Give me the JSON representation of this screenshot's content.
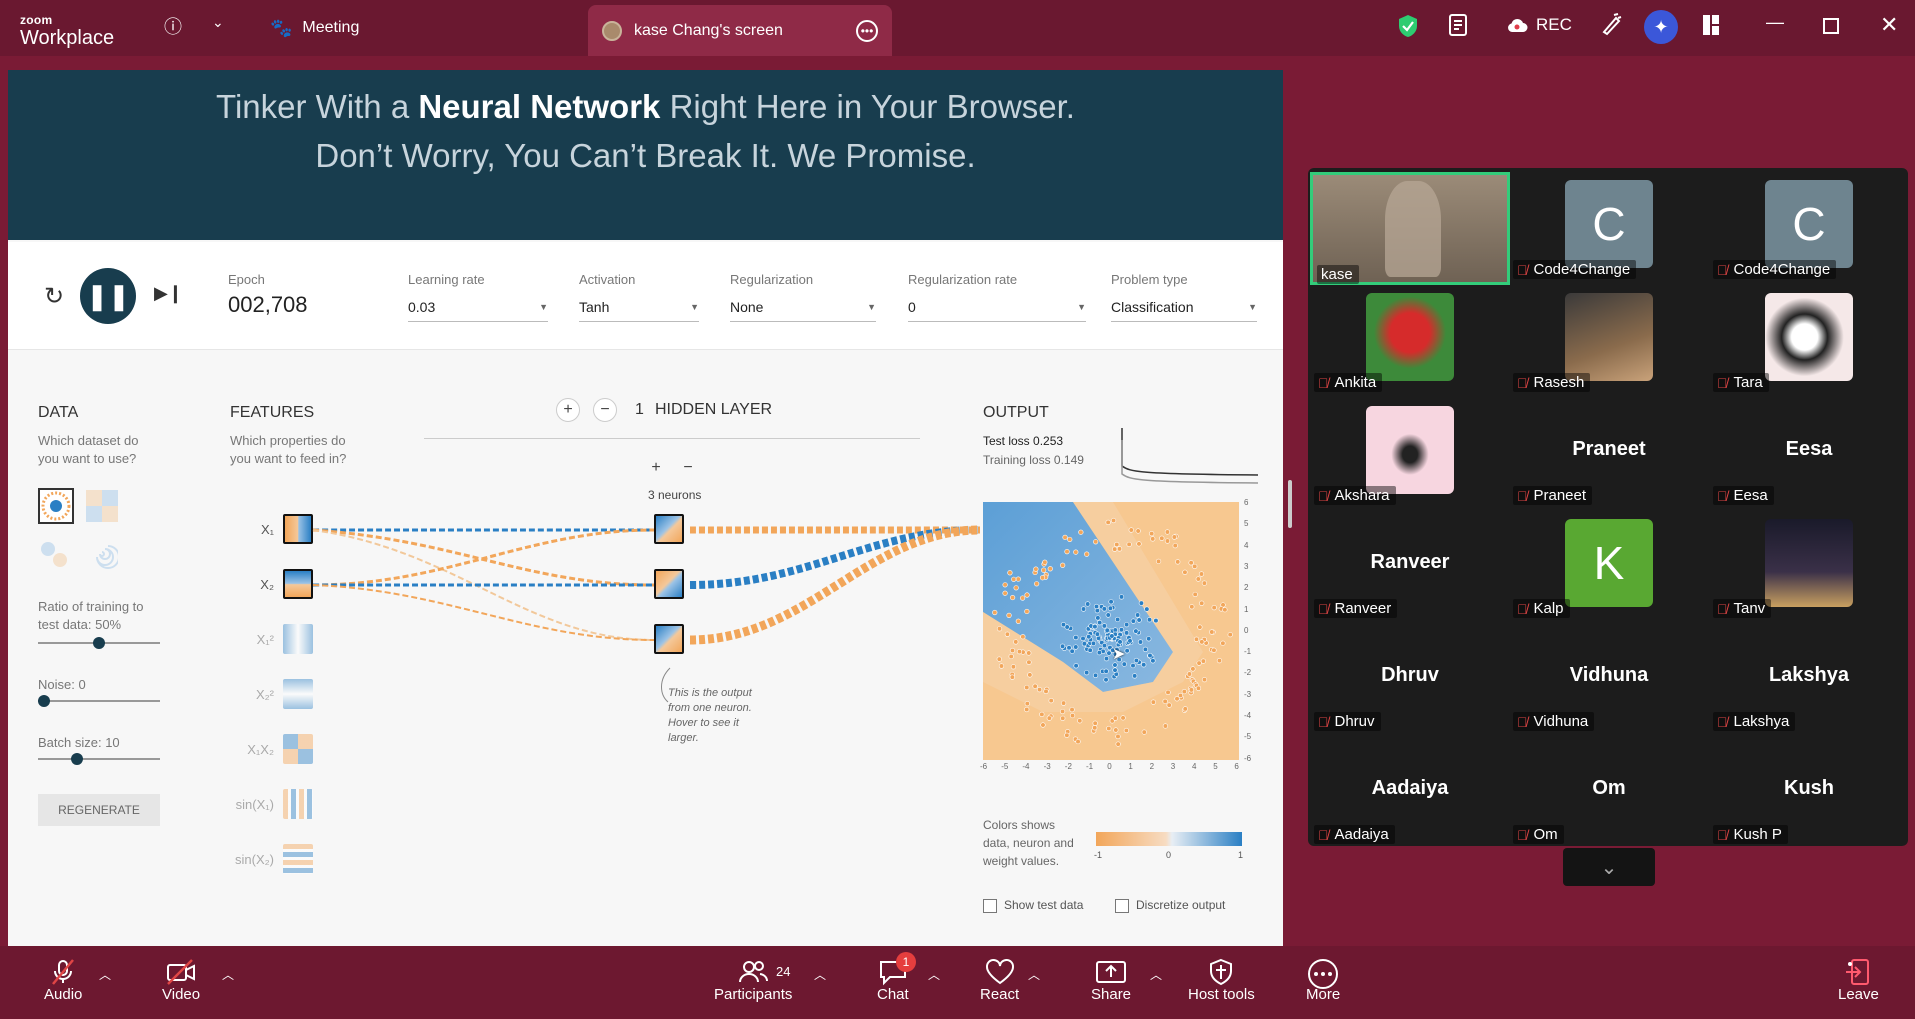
{
  "app": {
    "logo_small": "zoom",
    "logo_large": "Workplace",
    "meeting_tab": "Meeting",
    "screen_tab": "kase Chang's screen",
    "rec_label": "REC"
  },
  "playground": {
    "header_line1_pre": "Tinker With a ",
    "header_line1_bold": "Neural Network",
    "header_line1_post": " Right Here in Your Browser.",
    "header_line2": "Don’t Worry, You Can’t Break It. We Promise.",
    "epoch_label": "Epoch",
    "epoch_value": "002,708",
    "controls": [
      {
        "label": "Learning rate",
        "value": "0.03"
      },
      {
        "label": "Activation",
        "value": "Tanh"
      },
      {
        "label": "Regularization",
        "value": "None"
      },
      {
        "label": "Regularization rate",
        "value": "0"
      },
      {
        "label": "Problem type",
        "value": "Classification"
      }
    ],
    "data": {
      "title": "DATA",
      "subtitle1": "Which dataset do",
      "subtitle2": "you want to use?",
      "ratio_label1": "Ratio of training to",
      "ratio_label2": "test data:  50%",
      "ratio_value": 0.5,
      "noise_label": "Noise:  0",
      "noise_value": 0,
      "batch_label": "Batch size:  10",
      "batch_value": 0.3,
      "regenerate": "REGENERATE"
    },
    "features": {
      "title": "FEATURES",
      "subtitle1": "Which properties do",
      "subtitle2": "you want to feed in?",
      "items": [
        "X₁",
        "X₂",
        "X₁²",
        "X₂²",
        "X₁X₂",
        "sin(X₁)",
        "sin(X₂)"
      ]
    },
    "hidden": {
      "count": "1",
      "label": "HIDDEN LAYER",
      "neurons": "3 neurons",
      "note": [
        "This is the output",
        "from one neuron.",
        "Hover to see it",
        "larger."
      ]
    },
    "output": {
      "title": "OUTPUT",
      "test_loss": "Test loss 0.253",
      "training_loss": "Training loss 0.149",
      "y_ticks": [
        "6",
        "5",
        "4",
        "3",
        "2",
        "1",
        "0",
        "-1",
        "-2",
        "-3",
        "-4",
        "-5",
        "-6"
      ],
      "x_ticks": [
        "-6",
        "-5",
        "-4",
        "-3",
        "-2",
        "-1",
        "0",
        "1",
        "2",
        "3",
        "4",
        "5",
        "6"
      ],
      "legend_text": [
        "Colors shows",
        "data, neuron and",
        "weight values."
      ],
      "scale_labels": [
        "-1",
        "0",
        "1"
      ],
      "show_test": "Show test data",
      "discretize": "Discretize output"
    }
  },
  "participants": [
    {
      "tile_name": "",
      "label": "kase",
      "avatar": "video"
    },
    {
      "tile_name": "",
      "label": "Code4Change",
      "avatar": "C"
    },
    {
      "tile_name": "",
      "label": "Code4Change",
      "avatar": "C"
    },
    {
      "tile_name": "",
      "label": "Ankita",
      "avatar": "flower"
    },
    {
      "tile_name": "",
      "label": "Rasesh",
      "avatar": "photo"
    },
    {
      "tile_name": "",
      "label": "Tara",
      "avatar": "orca"
    },
    {
      "tile_name": "",
      "label": "Akshara",
      "avatar": "glasses"
    },
    {
      "tile_name": "Praneet",
      "label": "Praneet",
      "avatar": "none"
    },
    {
      "tile_name": "Eesa",
      "label": "Eesa",
      "avatar": "none"
    },
    {
      "tile_name": "Ranveer",
      "label": "Ranveer",
      "avatar": "none"
    },
    {
      "tile_name": "",
      "label": "Kalp",
      "avatar": "K"
    },
    {
      "tile_name": "",
      "label": "Tanv",
      "avatar": "city"
    },
    {
      "tile_name": "Dhruv",
      "label": "Dhruv",
      "avatar": "none"
    },
    {
      "tile_name": "Vidhuna",
      "label": "Vidhuna",
      "avatar": "none"
    },
    {
      "tile_name": "Lakshya",
      "label": "Lakshya",
      "avatar": "none"
    },
    {
      "tile_name": "Aadaiya",
      "label": "Aadaiya",
      "avatar": "none"
    },
    {
      "tile_name": "Om",
      "label": "Om",
      "avatar": "none"
    },
    {
      "tile_name": "Kush",
      "label": "Kush P",
      "avatar": "none"
    }
  ],
  "toolbar": {
    "audio": "Audio",
    "video": "Video",
    "participants": "Participants",
    "participants_count": "24",
    "chat": "Chat",
    "chat_badge": "1",
    "react": "React",
    "share": "Share",
    "host_tools": "Host tools",
    "more": "More",
    "leave": "Leave"
  },
  "colors": {
    "accent_blue": "#183d4e",
    "zoom_bar": "#6a1830",
    "orange": "#f2a65a",
    "blue": "#2a7fc4"
  }
}
